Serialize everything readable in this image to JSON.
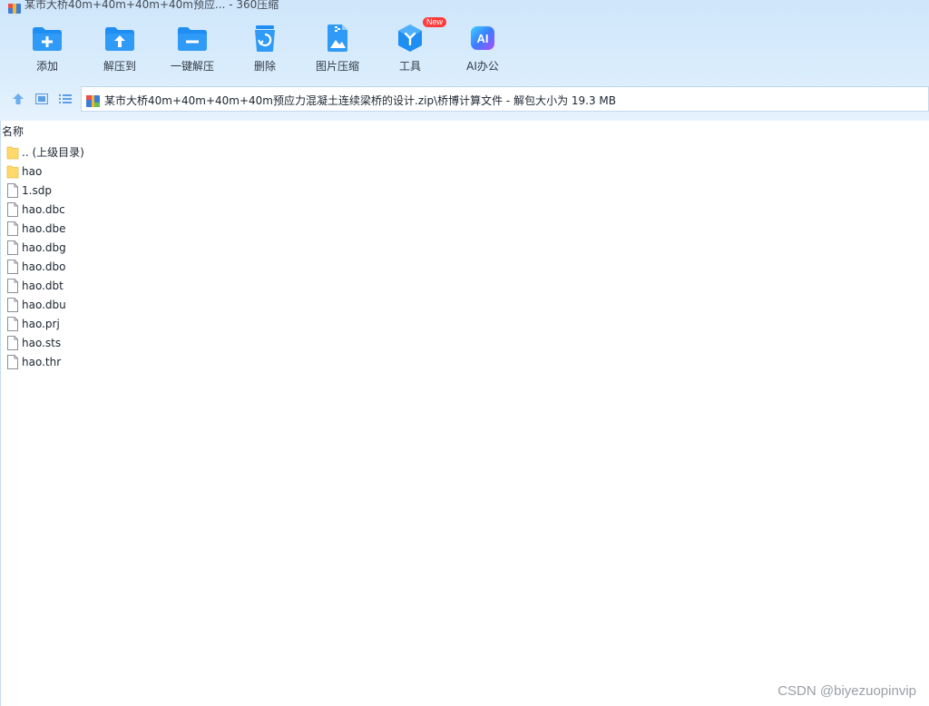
{
  "window": {
    "title": "某市大桥40m+40m+40m+40m预应... - 360压缩"
  },
  "toolbar": {
    "buttons": [
      {
        "label": "添加",
        "icon": "add-icon"
      },
      {
        "label": "解压到",
        "icon": "extract-to-icon"
      },
      {
        "label": "一键解压",
        "icon": "one-click-extract-icon"
      },
      {
        "label": "删除",
        "icon": "delete-icon"
      },
      {
        "label": "图片压缩",
        "icon": "image-compress-icon"
      },
      {
        "label": "工具",
        "icon": "tools-icon",
        "badge": "New"
      },
      {
        "label": "AI办公",
        "icon": "ai-office-icon",
        "glyph": "AI"
      }
    ]
  },
  "nav": {
    "icons": [
      "up-arrow-icon",
      "view-thumbnail-icon",
      "view-list-icon"
    ]
  },
  "address": {
    "path": "某市大桥40m+40m+40m+40m预应力混凝土连续梁桥的设计.zip\\桥博计算文件 - 解包大小为 19.3 MB"
  },
  "list": {
    "column_name": "名称",
    "items": [
      {
        "name": ".. (上级目录)",
        "type": "folder"
      },
      {
        "name": "hao",
        "type": "folder"
      },
      {
        "name": "1.sdp",
        "type": "file"
      },
      {
        "name": "hao.dbc",
        "type": "file"
      },
      {
        "name": "hao.dbe",
        "type": "file"
      },
      {
        "name": "hao.dbg",
        "type": "file"
      },
      {
        "name": "hao.dbo",
        "type": "file"
      },
      {
        "name": "hao.dbt",
        "type": "file"
      },
      {
        "name": "hao.dbu",
        "type": "file"
      },
      {
        "name": "hao.prj",
        "type": "file"
      },
      {
        "name": "hao.sts",
        "type": "file"
      },
      {
        "name": "hao.thr",
        "type": "file"
      }
    ]
  },
  "watermark": "CSDN @biyezuopinvip",
  "colors": {
    "accent_blue": "#1e8ef2",
    "folder_yellow": "#ffd86b",
    "badge_red": "#ff3b3b"
  }
}
